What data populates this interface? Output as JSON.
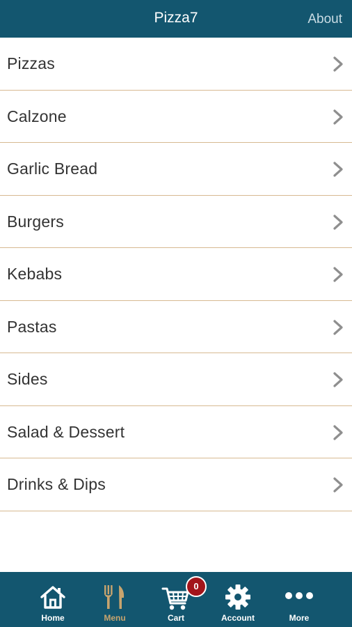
{
  "header": {
    "title": "Pizza7",
    "about_label": "About"
  },
  "menu": {
    "items": [
      {
        "label": "Pizzas"
      },
      {
        "label": "Calzone"
      },
      {
        "label": "Garlic Bread"
      },
      {
        "label": "Burgers"
      },
      {
        "label": "Kebabs"
      },
      {
        "label": "Pastas"
      },
      {
        "label": "Sides"
      },
      {
        "label": "Salad & Dessert"
      },
      {
        "label": "Drinks & Dips"
      }
    ]
  },
  "tabbar": {
    "tabs": [
      {
        "label": "Home",
        "icon": "home-icon"
      },
      {
        "label": "Menu",
        "icon": "fork-knife-icon",
        "active": true
      },
      {
        "label": "Cart",
        "icon": "cart-icon"
      },
      {
        "label": "Account",
        "icon": "gear-icon"
      },
      {
        "label": "More",
        "icon": "more-dots-icon"
      }
    ],
    "cart_count": "0"
  },
  "colors": {
    "primary": "#13566f",
    "divider": "#d7b991",
    "active_tab": "#c8a46e",
    "badge": "#a3141a"
  }
}
